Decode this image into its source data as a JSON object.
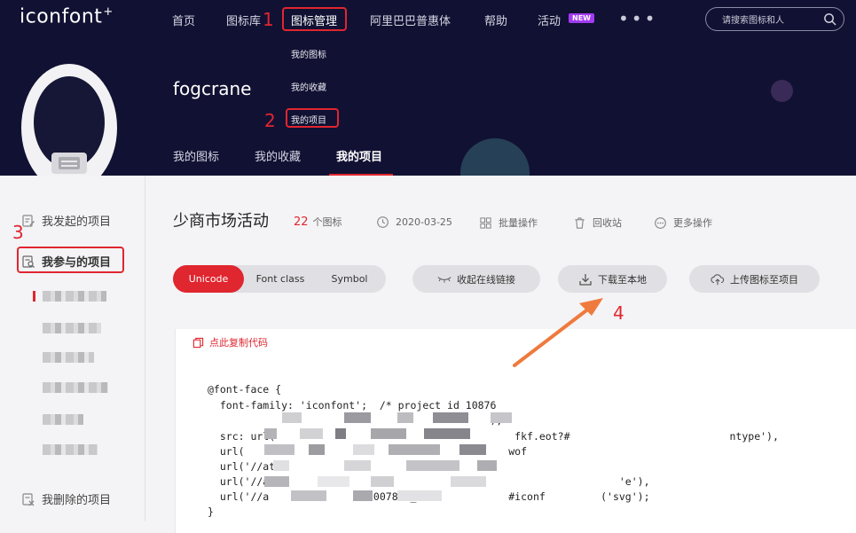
{
  "header": {
    "logo": "iconfont",
    "logo_plus": "+",
    "nav": [
      "首页",
      "图标库",
      "图标管理",
      "阿里巴巴普惠体",
      "帮助",
      "活动"
    ],
    "new_badge": "NEW",
    "more": "•••",
    "search_placeholder": "请搜索图标和人"
  },
  "dropdown": [
    "我的图标",
    "我的收藏",
    "我的项目"
  ],
  "profile": {
    "username": "fogcrane"
  },
  "subnav": [
    "我的图标",
    "我的收藏",
    "我的项目"
  ],
  "sidebar": {
    "initiated": "我发起的项目",
    "participating": "我参与的项目",
    "deleted": "我删除的项目"
  },
  "project": {
    "title": "少商市场活动",
    "icon_count": "22",
    "icon_count_unit": "个图标",
    "date": "2020-03-25",
    "batch": "批量操作",
    "recycle": "回收站",
    "more": "更多操作"
  },
  "tabs": [
    "Unicode",
    "Font class",
    "Symbol"
  ],
  "actions": {
    "collapse_link": "收起在线链接",
    "download": "下载至本地",
    "upload": "上传图标至项目"
  },
  "copy_code": "点此复制代码",
  "code_lines": [
    "@font-face {",
    "  font-family: 'iconfont';  /* project id 10876",
    "                                              );",
    "  src: url(                                       fkf.eot?#                          ntype'),",
    "  url(                                           wof",
    "  url('//at",
    "  url('//a                                                         'e'),",
    "  url('//a                 007890_2              #iconf         ('svg');",
    "}"
  ],
  "annotations": [
    "1",
    "2",
    "3",
    "4"
  ],
  "colors": {
    "accent": "#e0262f",
    "hero_bg": "#111133",
    "badge": "#a13bf0"
  }
}
